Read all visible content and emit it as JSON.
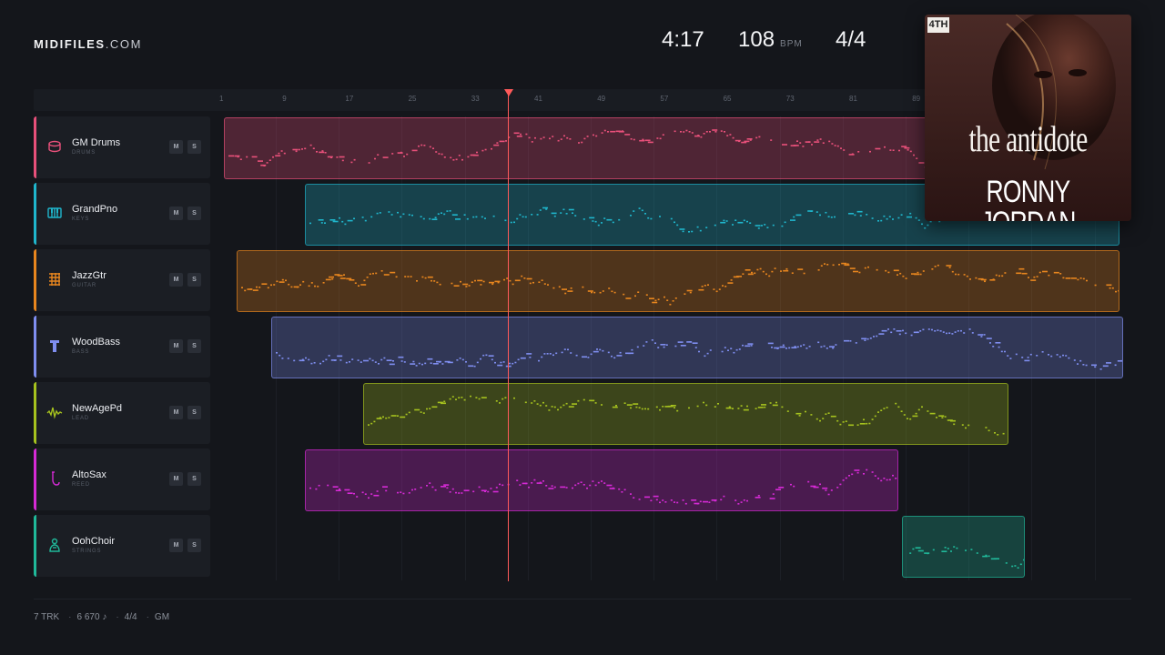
{
  "brand": {
    "bold": "MIDIFILES",
    "light": ".COM"
  },
  "transport": {
    "time": "4:17",
    "tempo": "108",
    "tempo_unit": "BPM",
    "signature": "4/4"
  },
  "ruler": {
    "bars": [
      "1",
      "9",
      "17",
      "25",
      "33",
      "41",
      "49",
      "57",
      "65",
      "73",
      "81",
      "89"
    ]
  },
  "playhead": {
    "bar": 37
  },
  "tracks": [
    {
      "name": "GM Drums",
      "category": "DRUMS",
      "color": "#e8507a",
      "icon": "drum-icon",
      "mute": "M",
      "solo": "S"
    },
    {
      "name": "GrandPno",
      "category": "KEYS",
      "color": "#1fb6cc",
      "icon": "piano-icon",
      "mute": "M",
      "solo": "S"
    },
    {
      "name": "JazzGtr",
      "category": "GUITAR",
      "color": "#e8861e",
      "icon": "guitar-icon",
      "mute": "M",
      "solo": "S"
    },
    {
      "name": "WoodBass",
      "category": "BASS",
      "color": "#7f8ef0",
      "icon": "bass-icon",
      "mute": "M",
      "solo": "S"
    },
    {
      "name": "NewAgePd",
      "category": "LEAD",
      "color": "#a6c21e",
      "icon": "wave-icon",
      "mute": "M",
      "solo": "S"
    },
    {
      "name": "AltoSax",
      "category": "REED",
      "color": "#d62ad6",
      "icon": "sax-icon",
      "mute": "M",
      "solo": "S"
    },
    {
      "name": "OohChoir",
      "category": "STRINGS",
      "color": "#20b99a",
      "icon": "choir-icon",
      "mute": "M",
      "solo": "S"
    }
  ],
  "album": {
    "title": "the antidote",
    "artist": "RONNY JORDAN",
    "badge": "4TH"
  },
  "status": {
    "tracks": "7 TRK",
    "notes": "6 670 ♪",
    "signature": "4/4",
    "standard": "GM"
  }
}
